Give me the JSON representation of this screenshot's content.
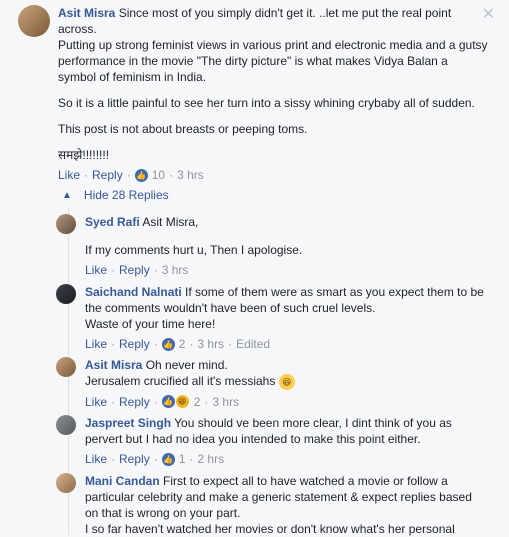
{
  "close_glyph": "✕",
  "main_comment": {
    "author": "Asit Misra",
    "paragraphs": [
      "Since most of you simply didn't get it. ..let me put the real point across.",
      "Putting up strong feminist views in various print and electronic media and a gutsy performance in the movie \"The dirty picture\" is what makes Vidya Balan a symbol of feminism in India.",
      "So it is a little painful to see her turn into a sissy whining crybaby all of sudden.",
      "This post is not about breasts or peeping toms.",
      "समझे!!!!!!!!"
    ],
    "like_label": "Like",
    "reply_label": "Reply",
    "reaction_count": "10",
    "time": "3 hrs"
  },
  "hide_replies_label": "Hide 28 Replies",
  "replies": [
    {
      "author": "Syed Rafi",
      "lines": [
        "Asit Misra,",
        "",
        "If my comments hurt u, Then I apologise."
      ],
      "like_label": "Like",
      "reply_label": "Reply",
      "reaction_count": "",
      "time": "3 hrs",
      "edited": ""
    },
    {
      "author": "Saichand Nalnati",
      "lines": [
        "If some of them were as smart as you expect them to be the comments wouldn't have been of such cruel levels.",
        "Waste of your time here!"
      ],
      "like_label": "Like",
      "reply_label": "Reply",
      "reaction_count": "2",
      "time": "3 hrs",
      "edited": "Edited"
    },
    {
      "author": "Asit Misra",
      "lines": [
        "Oh never mind.",
        "Jerusalem crucified all it's messiahs"
      ],
      "like_label": "Like",
      "reply_label": "Reply",
      "reaction_count": "2",
      "time": "3 hrs",
      "edited": ""
    },
    {
      "author": "Jaspreet Singh",
      "lines": [
        "You should ve been more clear, I dint think of you as pervert but I had no idea you intended to make this point either."
      ],
      "like_label": "Like",
      "reply_label": "Reply",
      "reaction_count": "1",
      "time": "2 hrs",
      "edited": ""
    },
    {
      "author": "Mani Candan",
      "lines": [
        "First to expect all to have watched a movie or follow a particular celebrity and make a generic statement & expect replies based on that is wrong on your part.",
        "I so far haven't watched her movies or don't know what's her personal"
      ]
    }
  ],
  "icons": {
    "like": "like-icon",
    "haha": "haha-icon",
    "laughing_emoji": "laughing-emoji-icon",
    "collapse_caret": "caret-up-icon",
    "close": "close-icon"
  },
  "colors": {
    "link_blue": "#365899",
    "like_blue": "#4267b2",
    "background": "#f6f7f9",
    "muted": "#90949c"
  }
}
